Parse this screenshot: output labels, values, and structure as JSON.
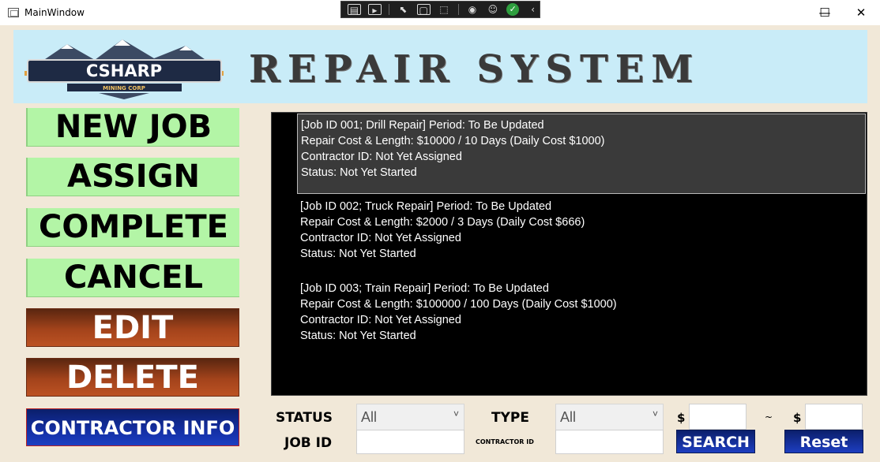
{
  "window": {
    "title": "MainWindow",
    "minimize": "—",
    "maximize": "☐",
    "close": "✕"
  },
  "debug_toolbar": {
    "icons": [
      "live-tree-icon",
      "video-icon",
      "select-element-icon",
      "display-layout-adorners-icon",
      "track-focus-icon",
      "hot-reload-icon",
      "accessibility-icon",
      "check-icon",
      "collapse-icon"
    ]
  },
  "banner": {
    "logo_text": "CSHARP",
    "logo_subtext": "MINING CORP",
    "title": "REPAIR SYSTEM"
  },
  "side_buttons": {
    "new_job": "NEW JOB",
    "assign": "ASSIGN",
    "complete": "COMPLETE",
    "cancel": "CANCEL",
    "edit": "EDIT",
    "delete": "DELETE",
    "contractor_info": "CONTRACTOR INFO"
  },
  "jobs": [
    {
      "line1": "[Job ID 001; Drill Repair]  Period: To Be Updated",
      "line2": "Repair Cost & Length: $10000 / 10 Days (Daily Cost $1000)",
      "line3": "Contractor ID: Not Yet Assigned",
      "line4": "Status: Not Yet Started",
      "selected": true
    },
    {
      "line1": "[Job ID 002; Truck Repair]  Period: To Be Updated",
      "line2": "Repair Cost & Length: $2000 / 3 Days (Daily Cost $666)",
      "line3": "Contractor ID: Not Yet Assigned",
      "line4": "Status: Not Yet Started",
      "selected": false
    },
    {
      "line1": "[Job ID 003; Train Repair]  Period: To Be Updated",
      "line2": "Repair Cost & Length: $100000 / 100 Days (Daily Cost $1000)",
      "line3": "Contractor ID: Not Yet Assigned",
      "line4": "Status: Not Yet Started",
      "selected": false
    }
  ],
  "filters": {
    "status_label": "STATUS",
    "status_value": "All",
    "type_label": "TYPE",
    "type_value": "All",
    "job_id_label": "JOB ID",
    "job_id_value": "",
    "contractor_id_label": "CONTRACTOR ID",
    "contractor_id_value": "",
    "dollar_min": "$",
    "min_value": "",
    "tilde": "~",
    "dollar_max": "$",
    "max_value": "",
    "search_label": "SEARCH",
    "reset_label": "Reset"
  }
}
